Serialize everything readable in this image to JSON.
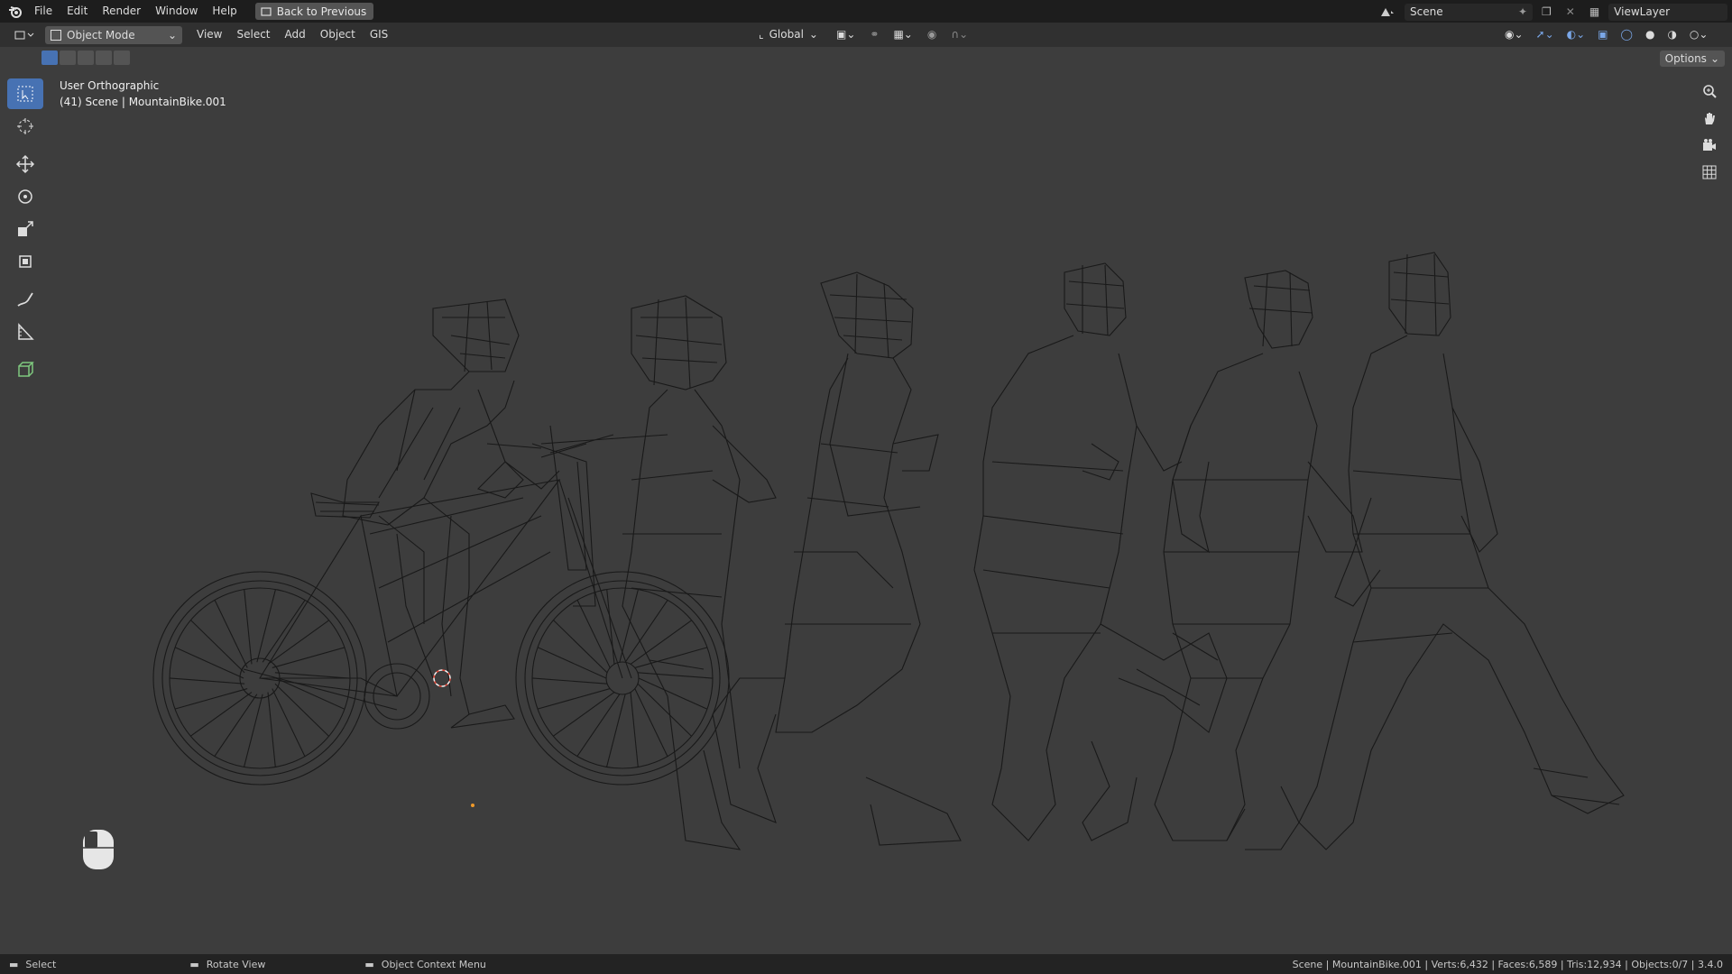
{
  "topbar": {
    "menus": [
      "File",
      "Edit",
      "Render",
      "Window",
      "Help"
    ],
    "back_button": "Back to Previous",
    "scene_field": "Scene",
    "viewlayer_field": "ViewLayer"
  },
  "header": {
    "mode": "Object Mode",
    "menus": [
      "View",
      "Select",
      "Add",
      "Object",
      "GIS"
    ],
    "transform_orientation": "Global",
    "options": "Options"
  },
  "viewport": {
    "view_name": "User Orthographic",
    "scene_info": "(41) Scene | MountainBike.001"
  },
  "status": {
    "select": "Select",
    "rotate": "Rotate View",
    "context_menu": "Object Context Menu",
    "stats": "Scene | MountainBike.001 | Verts:6,432 | Faces:6,589 | Tris:12,934 | Objects:0/7 | 3.4.0"
  },
  "colors": {
    "accent": "#4772b3",
    "wire": "#141414",
    "background": "#3d3d3d"
  }
}
